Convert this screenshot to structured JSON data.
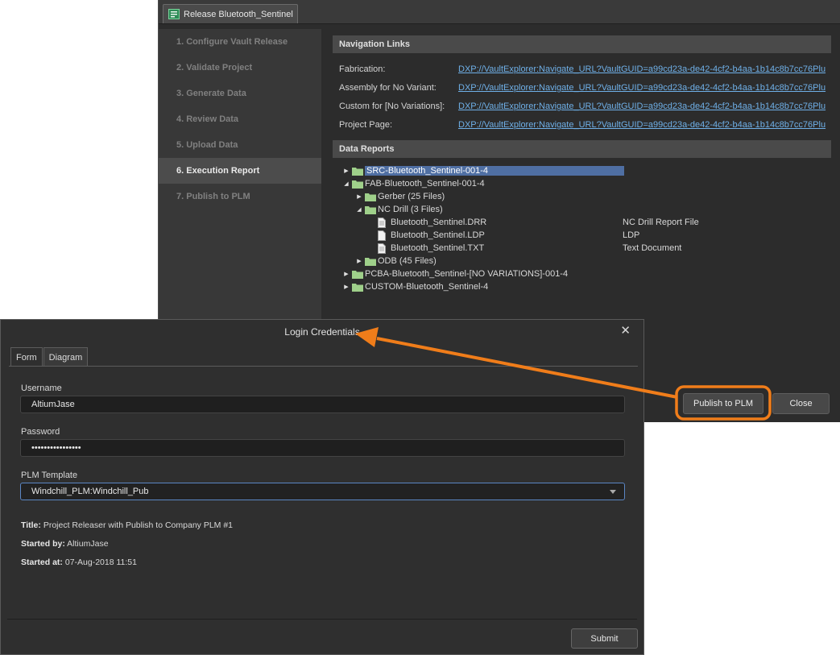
{
  "release_window": {
    "tab_title": "Release Bluetooth_Sentinel",
    "steps": [
      {
        "label": "1. Configure Vault Release",
        "active": false
      },
      {
        "label": "2. Validate Project",
        "active": false
      },
      {
        "label": "3. Generate Data",
        "active": false
      },
      {
        "label": "4. Review Data",
        "active": false
      },
      {
        "label": "5. Upload Data",
        "active": false
      },
      {
        "label": "6. Execution Report",
        "active": true
      },
      {
        "label": "7. Publish to PLM",
        "active": false
      }
    ],
    "navigation_links_header": "Navigation Links",
    "navigation_links": [
      {
        "label": "Fabrication:",
        "link": "DXP://VaultExplorer:Navigate_URL?VaultGUID=a99cd23a-de42-4cf2-b4aa-1b14c8b7cc76Plu"
      },
      {
        "label": "Assembly for No Variant:",
        "link": "DXP://VaultExplorer:Navigate_URL?VaultGUID=a99cd23a-de42-4cf2-b4aa-1b14c8b7cc76Plu"
      },
      {
        "label": "Custom for [No Variations]:",
        "link": "DXP://VaultExplorer:Navigate_URL?VaultGUID=a99cd23a-de42-4cf2-b4aa-1b14c8b7cc76Plu"
      },
      {
        "label": "Project Page:",
        "link": "DXP://VaultExplorer:Navigate_URL?VaultGUID=a99cd23a-de42-4cf2-b4aa-1b14c8b7cc76Plu"
      }
    ],
    "data_reports_header": "Data Reports",
    "tree": {
      "src": "SRC-Bluetooth_Sentinel-001-4",
      "fab": "FAB-Bluetooth_Sentinel-001-4",
      "gerber": "Gerber (25 Files)",
      "nc_drill": "NC Drill (3 Files)",
      "files": [
        {
          "name": "Bluetooth_Sentinel.DRR",
          "desc": "NC Drill Report File"
        },
        {
          "name": "Bluetooth_Sentinel.LDP",
          "desc": "LDP"
        },
        {
          "name": "Bluetooth_Sentinel.TXT",
          "desc": "Text Document"
        }
      ],
      "odb": "ODB (45 Files)",
      "pcba": "PCBA-Bluetooth_Sentinel-[NO VARIATIONS]-001-4",
      "custom": "CUSTOM-Bluetooth_Sentinel-4"
    },
    "publish_button": "Publish to PLM",
    "close_button": "Close"
  },
  "login_dialog": {
    "title": "Login Credentials",
    "close_glyph": "✕",
    "tabs": [
      "Form",
      "Diagram"
    ],
    "username_label": "Username",
    "username_value": "AltiumJase",
    "password_label": "Password",
    "password_value": "••••••••••••••••",
    "template_label": "PLM Template",
    "template_value": "Windchill_PLM:Windchill_Pub",
    "title_key": "Title:",
    "title_value": " Project Releaser with Publish to Company PLM #1",
    "started_by_key": "Started by:",
    "started_by_value": " AltiumJase",
    "started_at_key": "Started at:",
    "started_at_value": " 07-Aug-2018 11:51",
    "submit_button": "Submit"
  },
  "colors": {
    "annotation": "#f07d1a",
    "link": "#6fb0e8",
    "selection": "#4f6fa3",
    "folder": "#9fd08a"
  },
  "icons": {
    "doc_tab": "release-doc-icon",
    "folder": "folder-icon",
    "file": "file-icon",
    "expand": "triangle-right-icon",
    "collapse": "triangle-down-icon"
  }
}
